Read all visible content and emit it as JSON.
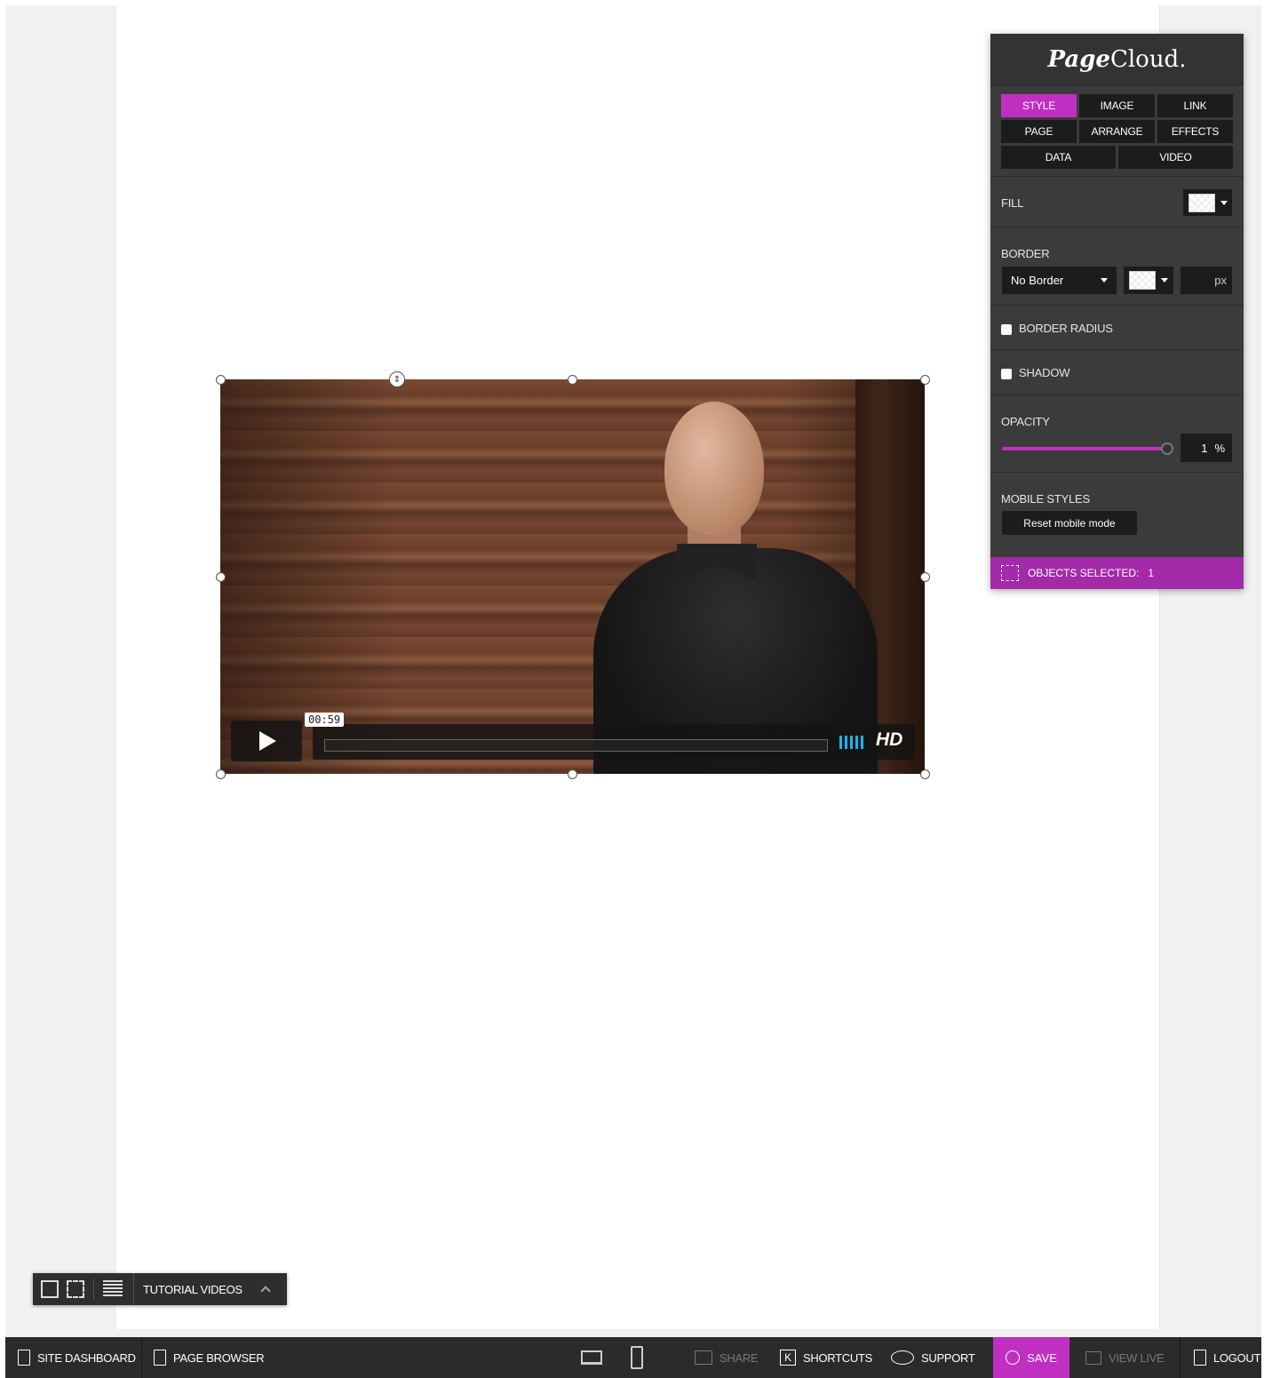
{
  "panel": {
    "logo_script": "Page",
    "logo_rest": "Cloud.",
    "tabs_row1": [
      "STYLE",
      "IMAGE",
      "LINK"
    ],
    "tabs_row2": [
      "PAGE",
      "ARRANGE",
      "EFFECTS"
    ],
    "tabs_row3": [
      "DATA",
      "VIDEO"
    ],
    "active_tab": "STYLE",
    "fill_label": "FILL",
    "border_label": "BORDER",
    "border_style": "No Border",
    "border_unit": "px",
    "border_radius_label": "BORDER RADIUS",
    "shadow_label": "SHADOW",
    "opacity_label": "OPACITY",
    "opacity_value": "1",
    "opacity_unit": "%",
    "mobile_styles_label": "MOBILE STYLES",
    "reset_mobile_label": "Reset mobile mode",
    "objects_selected_label": "OBJECTS SELECTED:",
    "objects_selected_count": "1",
    "accent_color": "#c12fc2"
  },
  "video": {
    "timecode": "00:59",
    "quality_label": "HD",
    "volume_color": "#1ab7ea"
  },
  "tutorial": {
    "label": "TUTORIAL VIDEOS"
  },
  "bottombar": {
    "site_dashboard": "SITE DASHBOARD",
    "page_browser": "PAGE BROWSER",
    "share": "SHARE",
    "shortcuts": "SHORTCUTS",
    "shortcuts_key": "K",
    "support": "SUPPORT",
    "save": "SAVE",
    "view_live": "VIEW LIVE",
    "logout": "LOGOUT"
  }
}
